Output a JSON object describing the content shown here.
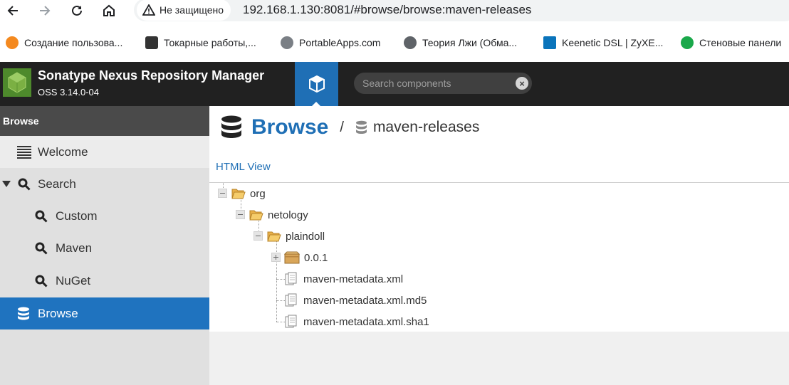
{
  "browser": {
    "security_label": "Не защищено",
    "url": "192.168.1.130:8081/#browse/browse:maven-releases",
    "bookmarks": [
      {
        "label": "Создание пользова...",
        "color": "#f4891f"
      },
      {
        "label": "Токарные работы,...",
        "color": "#333333"
      },
      {
        "label": "PortableApps.com",
        "color": "#5f6368"
      },
      {
        "label": "Теория Лжи (Обма...",
        "color": "#5f6368"
      },
      {
        "label": "Keenetic DSL | ZyXE...",
        "color": "#0a74bb"
      },
      {
        "label": "Стеновые панели",
        "color": "#1aa84a"
      }
    ]
  },
  "header": {
    "title": "Sonatype Nexus Repository Manager",
    "version": "OSS 3.14.0-04",
    "search_placeholder": "Search components"
  },
  "sidebar": {
    "heading": "Browse",
    "items": [
      {
        "label": "Welcome"
      },
      {
        "label": "Search"
      },
      {
        "label": "Custom"
      },
      {
        "label": "Maven"
      },
      {
        "label": "NuGet"
      },
      {
        "label": "Browse"
      }
    ]
  },
  "main": {
    "title": "Browse",
    "separator": "/",
    "repository": "maven-releases",
    "html_view_link": "HTML View",
    "tree": [
      {
        "label": "org",
        "type": "folder"
      },
      {
        "label": "netology",
        "type": "folder"
      },
      {
        "label": "plaindoll",
        "type": "folder"
      },
      {
        "label": "0.0.1",
        "type": "component"
      },
      {
        "label": "maven-metadata.xml",
        "type": "file"
      },
      {
        "label": "maven-metadata.xml.md5",
        "type": "file"
      },
      {
        "label": "maven-metadata.xml.sha1",
        "type": "file"
      }
    ]
  },
  "colors": {
    "accent": "#1f6fb5",
    "header_bg": "#212121",
    "sidebar_bg": "#e0e0e0",
    "active_item": "#1f73bf"
  }
}
